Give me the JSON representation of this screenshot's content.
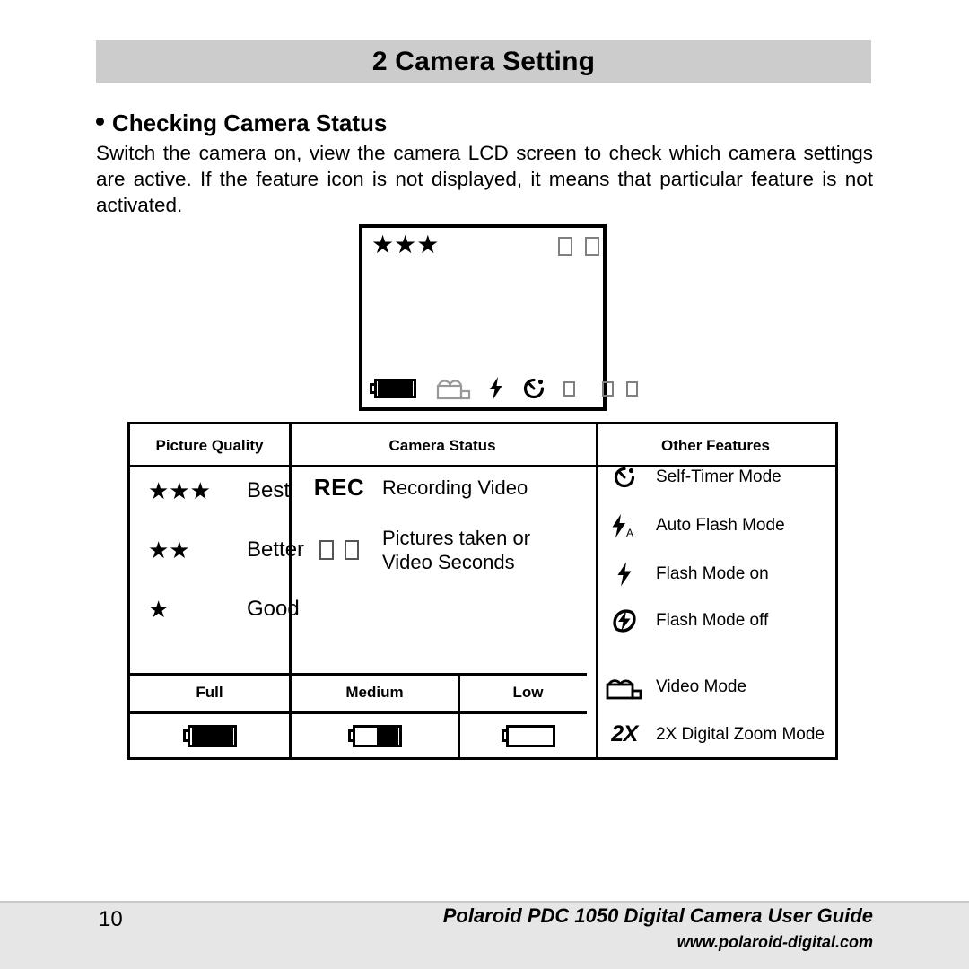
{
  "chapter": {
    "title": "2 Camera Setting"
  },
  "section": {
    "heading": "Checking Camera Status",
    "bullet_icon": "bullet-dot-icon",
    "paragraph": "Switch the camera on, view the camera LCD screen to check which camera settings are active. If the feature icon is not displayed, it means that particular feature is not activated."
  },
  "lcd_display": {
    "name": "camera-lcd-screen",
    "top_left_quality_stars": "★★★",
    "top_right_counter_digits": [
      "digit-box-icon",
      "digit-box-icon"
    ],
    "bottom_icons": [
      "battery-full-icon",
      "video-mode-icon",
      "flash-on-icon",
      "self-timer-icon",
      "digit-box-icon",
      "digit-box-icon",
      "digit-box-icon"
    ]
  },
  "table": {
    "headers": {
      "picture_quality": "Picture Quality",
      "camera_status": "Camera Status",
      "other_features": "Other Features"
    },
    "picture_quality_rows": [
      {
        "stars": "★★★",
        "star_count": 3,
        "label": "Best"
      },
      {
        "stars": "★★",
        "star_count": 2,
        "label": "Better"
      },
      {
        "stars": "★",
        "star_count": 1,
        "label": "Good"
      }
    ],
    "camera_status_rows": [
      {
        "icon": "rec-text-icon",
        "icon_text": "REC",
        "label": "Recording Video"
      },
      {
        "icon": "digit-boxes-icon",
        "label_line1": "Pictures taken or",
        "label_line2": "Video Seconds"
      }
    ],
    "other_features_rows": [
      {
        "icon": "self-timer-icon",
        "label": "Self-Timer Mode"
      },
      {
        "icon": "auto-flash-icon",
        "label": "Auto Flash Mode"
      },
      {
        "icon": "flash-on-icon",
        "label": "Flash Mode on"
      },
      {
        "icon": "flash-off-icon",
        "label": "Flash Mode off"
      },
      {
        "icon": "video-mode-icon",
        "label": "Video Mode"
      },
      {
        "icon": "digital-zoom-icon",
        "icon_text": "2X",
        "label": "2X Digital Zoom Mode"
      }
    ],
    "battery_headers": [
      "Full",
      "Medium",
      "Low"
    ],
    "battery_icons": [
      "battery-full-icon",
      "battery-medium-icon",
      "battery-low-icon"
    ]
  },
  "footer": {
    "page_number": "10",
    "guide_title": "Polaroid PDC 1050 Digital Camera User Guide",
    "url": "www.polaroid-digital.com"
  },
  "colors": {
    "chapter_bar": "#cccccc",
    "footer_bar": "#e6e6e6",
    "ink": "#000000",
    "inactive_icon": "#999999",
    "page": "#ffffff"
  }
}
